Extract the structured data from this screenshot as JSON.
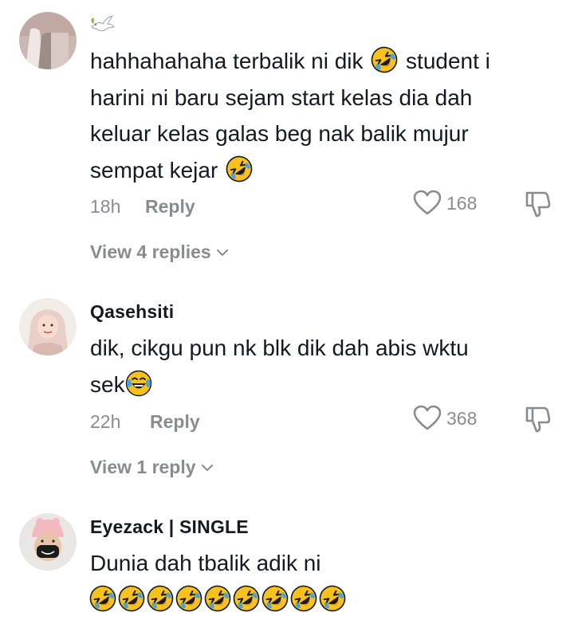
{
  "comments": [
    {
      "username": "",
      "text_line1": "hahhahahaha terbalik ni dik",
      "text_line1_after": "student i",
      "text_line2": "harini ni baru sejam start kelas dia dah",
      "text_line3": "keluar kelas galas beg nak balik mujur",
      "text_line4": "sempat kejar",
      "time": "18h",
      "reply_label": "Reply",
      "likes": "168",
      "view_replies": "View 4 replies"
    },
    {
      "username": "Qasehsiti",
      "text_line1": "dik, cikgu pun nk blk dik dah abis wktu",
      "text_line2": "sek",
      "time": "22h",
      "reply_label": "Reply",
      "likes": "368",
      "view_replies": "View 1 reply"
    },
    {
      "username": "Eyezack | SINGLE",
      "text_line1": "Dunia dah tbalik adik ni"
    }
  ],
  "colors": {
    "text": "#161823",
    "secondary": "#8a8b91",
    "emoji_yellow": "#f7c21b"
  },
  "icons": [
    "dove-icon",
    "rofl-emoji",
    "joy-emoji",
    "heart-icon",
    "thumbs-down-icon",
    "chevron-down-icon"
  ]
}
